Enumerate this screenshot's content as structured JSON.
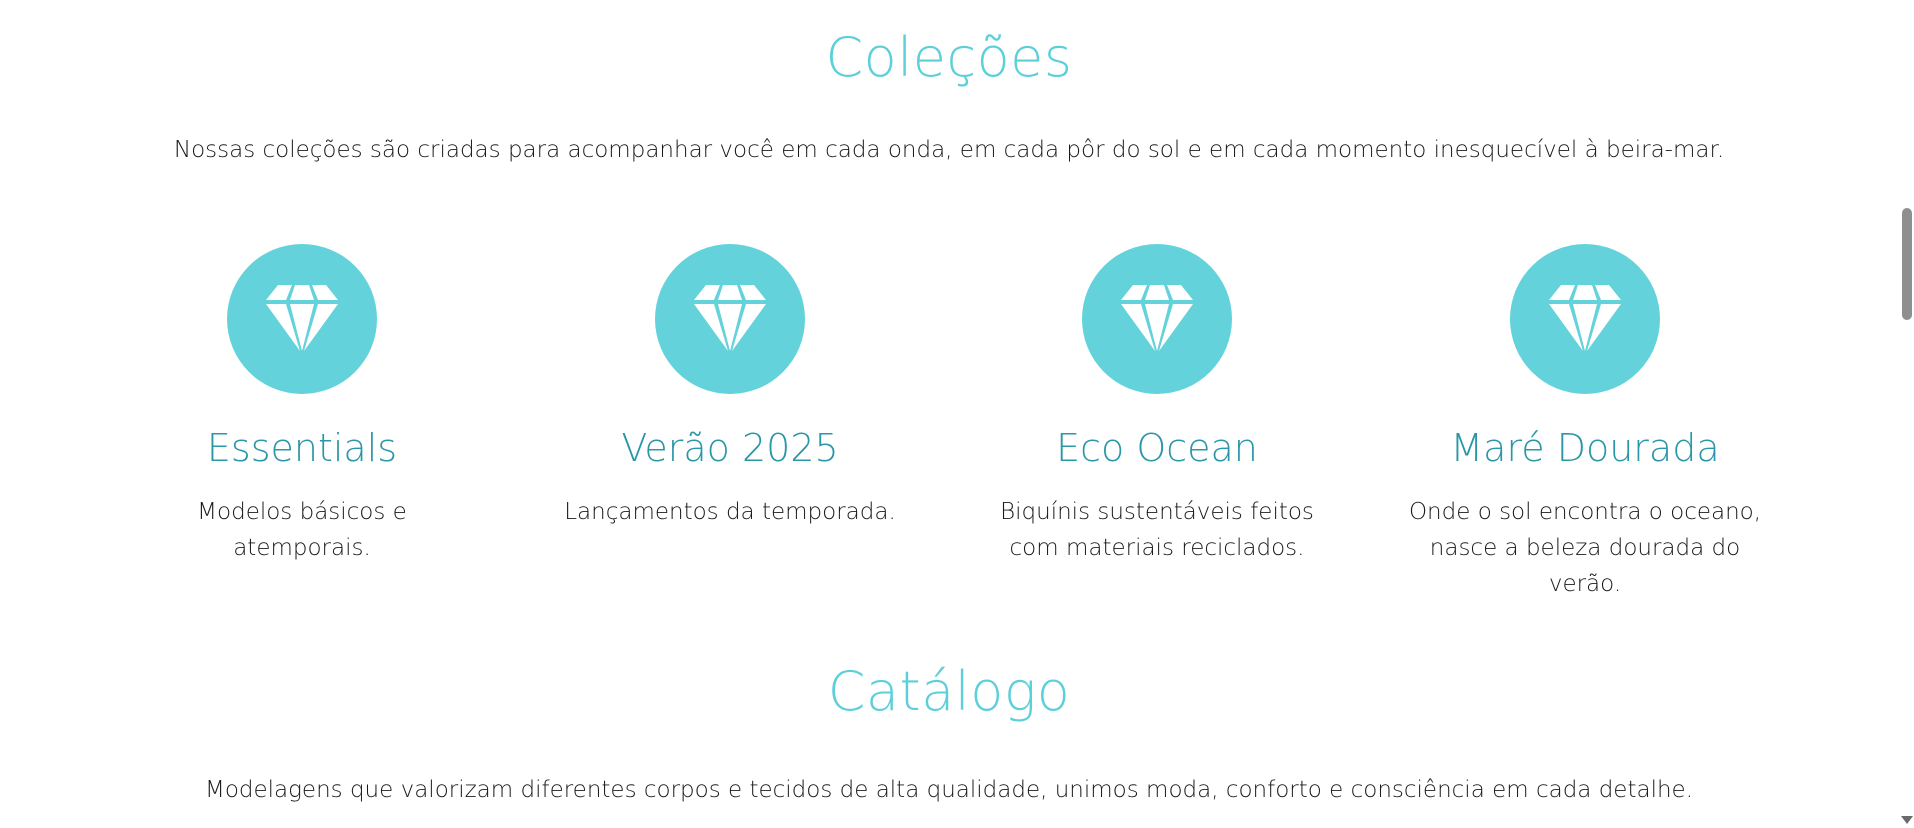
{
  "colecoes": {
    "title": "Coleções",
    "description": "Nossas coleções são criadas para acompanhar você em cada onda, em cada pôr do sol e em cada momento inesquecível à beira-mar.",
    "accent_color": "#63d2db",
    "title_color": "#5ccfd9",
    "card_title_color": "#2a97a8",
    "items": [
      {
        "icon": "diamond-icon",
        "title": "Essentials",
        "description": "Modelos básicos e atemporais."
      },
      {
        "icon": "diamond-icon",
        "title": "Verão 2025",
        "description": "Lançamentos da temporada."
      },
      {
        "icon": "diamond-icon",
        "title": "Eco Ocean",
        "description": "Biquínis sustentáveis feitos com materiais reciclados."
      },
      {
        "icon": "diamond-icon",
        "title": "Maré Dourada",
        "description": "Onde o sol encontra o oceano, nasce a beleza dourada do verão."
      }
    ]
  },
  "catalogo": {
    "title": "Catálogo",
    "description": "Modelagens que valorizam diferentes corpos e tecidos de alta qualidade, unimos moda, conforto e consciência em cada detalhe."
  }
}
